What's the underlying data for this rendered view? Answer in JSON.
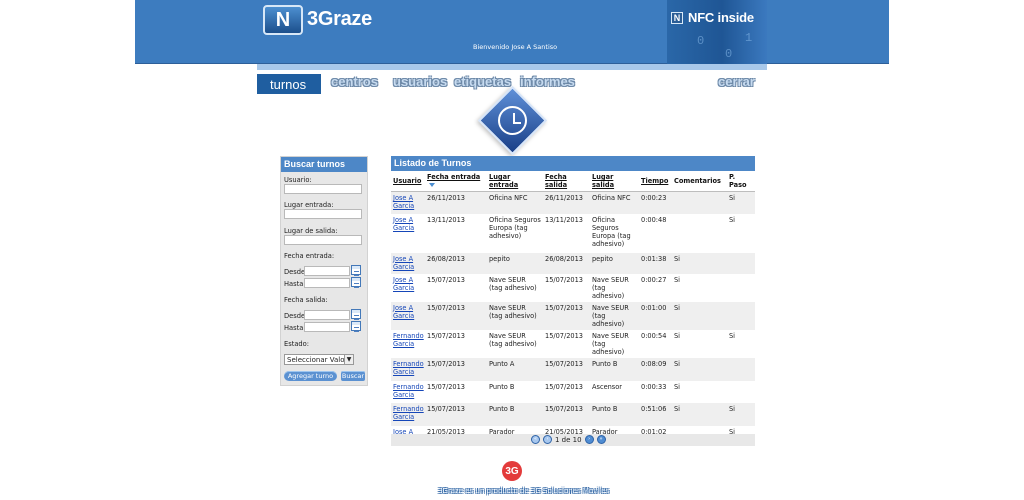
{
  "header": {
    "brand": "3Graze",
    "welcome": "Bienvenido Jose A Santiso",
    "nfc_label": "NFC inside"
  },
  "nav": [
    {
      "label": "turnos"
    },
    {
      "label": "centros"
    },
    {
      "label": "usuarios"
    },
    {
      "label": "etiquetas"
    },
    {
      "label": "informes"
    },
    {
      "label": "cerrar"
    }
  ],
  "search": {
    "title": "Buscar turnos",
    "usuario_label": "Usuario:",
    "lugar_entrada_label": "Lugar entrada:",
    "lugar_salida_label": "Lugar de salida:",
    "fecha_entrada_label": "Fecha entrada:",
    "fecha_salida_label": "Fecha salida:",
    "desde_label": "Desde",
    "hasta_label": "Hasta",
    "estado_label": "Estado:",
    "select_value": "Seleccionar Valor",
    "add_button": "Agregar turno",
    "search_button": "Buscar"
  },
  "list": {
    "title": "Listado de Turnos",
    "columns": [
      "Usuario",
      "Fecha entrada",
      "Lugar entrada",
      "Fecha salida",
      "Lugar salida",
      "Tiempo",
      "Comentarios",
      "P. Paso"
    ],
    "rows": [
      {
        "usuario": "Jose A Garcia",
        "fecha_entrada": "26/11/2013",
        "lugar_entrada": "Oficina NFC",
        "fecha_salida": "26/11/2013",
        "lugar_salida": "Oficina NFC",
        "tiempo": "0:00:23",
        "comentarios": "",
        "paso": "Si"
      },
      {
        "usuario": "Jose A Garcia",
        "fecha_entrada": "13/11/2013",
        "lugar_entrada": "Oficina Seguros Europa (tag adhesivo)",
        "fecha_salida": "13/11/2013",
        "lugar_salida": "Oficina Seguros Europa (tag adhesivo)",
        "tiempo": "0:00:48",
        "comentarios": "",
        "paso": "Si"
      },
      {
        "usuario": "Jose A Garcia",
        "fecha_entrada": "26/08/2013",
        "lugar_entrada": "pepito",
        "fecha_salida": "26/08/2013",
        "lugar_salida": "pepito",
        "tiempo": "0:01:38",
        "comentarios": "Si",
        "paso": ""
      },
      {
        "usuario": "Jose A Garcia",
        "fecha_entrada": "15/07/2013",
        "lugar_entrada": "Nave SEUR (tag adhesivo)",
        "fecha_salida": "15/07/2013",
        "lugar_salida": "Nave SEUR (tag adhesivo)",
        "tiempo": "0:00:27",
        "comentarios": "Si",
        "paso": ""
      },
      {
        "usuario": "Jose A Garcia",
        "fecha_entrada": "15/07/2013",
        "lugar_entrada": "Nave SEUR (tag adhesivo)",
        "fecha_salida": "15/07/2013",
        "lugar_salida": "Nave SEUR (tag adhesivo)",
        "tiempo": "0:01:00",
        "comentarios": "Si",
        "paso": ""
      },
      {
        "usuario": "Fernando Garcia",
        "fecha_entrada": "15/07/2013",
        "lugar_entrada": "Nave SEUR (tag adhesivo)",
        "fecha_salida": "15/07/2013",
        "lugar_salida": "Nave SEUR (tag adhesivo)",
        "tiempo": "0:00:54",
        "comentarios": "Si",
        "paso": "Si"
      },
      {
        "usuario": "Fernando Garcia",
        "fecha_entrada": "15/07/2013",
        "lugar_entrada": "Punto A",
        "fecha_salida": "15/07/2013",
        "lugar_salida": "Punto B",
        "tiempo": "0:08:09",
        "comentarios": "Si",
        "paso": ""
      },
      {
        "usuario": "Fernando Garcia",
        "fecha_entrada": "15/07/2013",
        "lugar_entrada": "Punto B",
        "fecha_salida": "15/07/2013",
        "lugar_salida": "Ascensor",
        "tiempo": "0:00:33",
        "comentarios": "Si",
        "paso": ""
      },
      {
        "usuario": "Fernando Garcia",
        "fecha_entrada": "15/07/2013",
        "lugar_entrada": "Punto B",
        "fecha_salida": "15/07/2013",
        "lugar_salida": "Punto B",
        "tiempo": "0:51:06",
        "comentarios": "Si",
        "paso": "Si"
      },
      {
        "usuario": "Jose A Garcia",
        "fecha_entrada": "21/05/2013",
        "lugar_entrada": "Parador Calahorra",
        "fecha_salida": "21/05/2013",
        "lugar_salida": "Parador Calahorra",
        "tiempo": "0:01:02",
        "comentarios": "",
        "paso": "Si"
      }
    ],
    "pagination": "1 de 10"
  },
  "footer": {
    "logo": "3G",
    "text": "3Graze es un producto de 3G Soluciones Moviles"
  },
  "icons": [
    "nfc-logo-icon",
    "clock-icon",
    "calendar-icon",
    "sort-arrow-icon",
    "first-page-icon",
    "previous-page-icon",
    "next-page-icon",
    "last-page-icon"
  ],
  "colors": {
    "header": "#3d7cbf",
    "nav_active": "#1f5ea0",
    "link": "#1546b8",
    "table_alt": "#efefef"
  }
}
